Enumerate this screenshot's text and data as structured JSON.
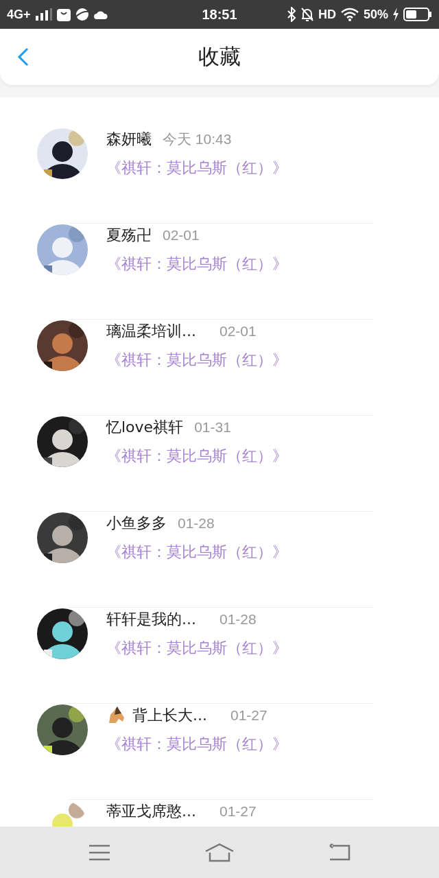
{
  "status_bar": {
    "network": "4G+",
    "time": "18:51",
    "hd": "HD",
    "battery": "50%"
  },
  "header": {
    "title": "收藏"
  },
  "items": [
    {
      "name": "森妍曦",
      "date": "今天 10:43",
      "title": "《祺轩：莫比乌斯（红）》",
      "icon": false
    },
    {
      "name": "夏殇卍",
      "date": "02-01",
      "title": "《祺轩：莫比乌斯（红）》",
      "icon": false
    },
    {
      "name": "璃温柔培训...",
      "date": "02-01",
      "title": "《祺轩：莫比乌斯（红）》",
      "icon": false
    },
    {
      "name": "忆love祺轩",
      "date": "01-31",
      "title": "《祺轩：莫比乌斯（红）》",
      "icon": false
    },
    {
      "name": "小鱼多多",
      "date": "01-28",
      "title": "《祺轩：莫比乌斯（红）》",
      "icon": false
    },
    {
      "name": "轩轩是我的...",
      "date": "01-28",
      "title": "《祺轩：莫比乌斯（红）》",
      "icon": false
    },
    {
      "name": "背上长大...",
      "date": "01-27",
      "title": "《祺轩：莫比乌斯（红）》",
      "icon": true
    },
    {
      "name": "蒂亚戈席憨...",
      "date": "01-27",
      "icon": false
    }
  ]
}
